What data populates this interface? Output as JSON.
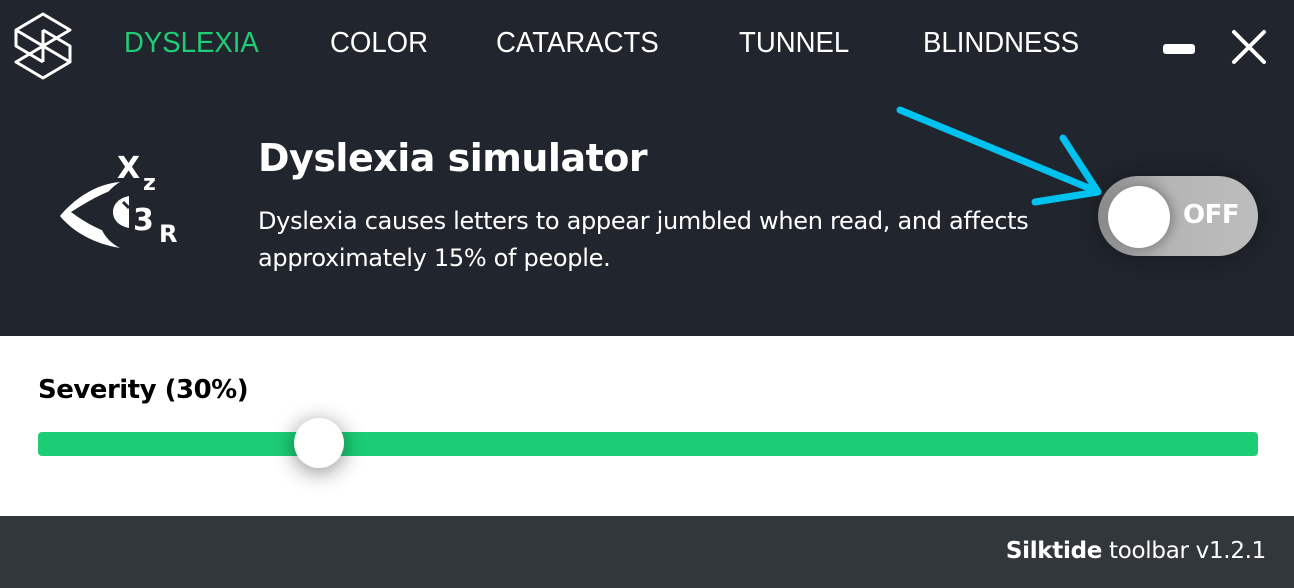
{
  "header": {
    "logo_icon": "silktide-logo-icon",
    "tabs": [
      {
        "label": "DYSLEXIA",
        "active": true
      },
      {
        "label": "COLOR",
        "active": false
      },
      {
        "label": "CATARACTS",
        "active": false
      },
      {
        "label": "TUNNEL",
        "active": false
      },
      {
        "label": "BLINDNESS",
        "active": false
      }
    ],
    "minimize_icon": "minimize-icon",
    "close_icon": "close-icon"
  },
  "simulator": {
    "icon": "dyslexia-eye-icon",
    "title": "Dyslexia simulator",
    "description": "Dyslexia causes letters to appear jumbled when read, and affects approximately 15% of people.",
    "toggle": {
      "state": "off",
      "label": "OFF"
    },
    "annotation": "cyan-arrow-pointing-at-toggle"
  },
  "severity": {
    "label": "Severity (30%)",
    "value_percent": 30,
    "thumb_fraction": 0.23
  },
  "footer": {
    "brand": "Silktide",
    "text": "toolbar v1.2.1"
  },
  "colors": {
    "background_dark": "#21252d",
    "accent_green": "#1ecd75",
    "footer_bg": "#32373c",
    "arrow_cyan": "#00c2ef",
    "toggle_gray": "#b5b5b5"
  }
}
